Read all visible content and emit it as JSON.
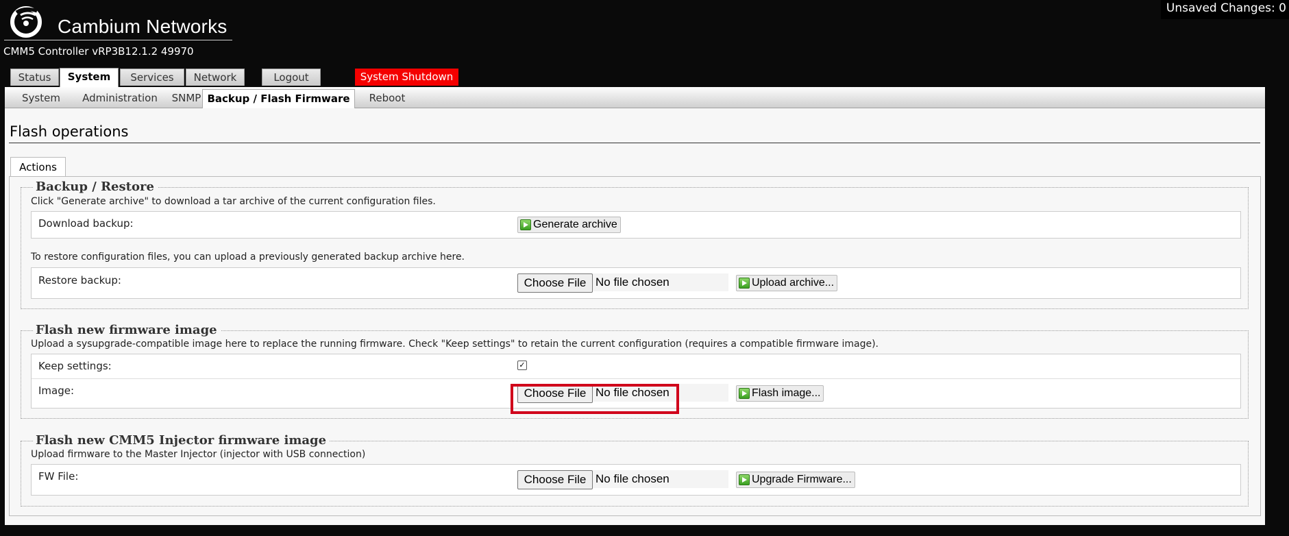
{
  "header": {
    "brand": "Cambium Networks",
    "version": "CMM5 Controller vRP3B12.1.2 49970",
    "unsaved_changes": "Unsaved Changes: 0"
  },
  "main_tabs": [
    {
      "label": "Status",
      "active": false
    },
    {
      "label": "System",
      "active": true
    },
    {
      "label": "Services",
      "active": false
    },
    {
      "label": "Network",
      "active": false
    },
    {
      "label": "Logout",
      "active": false
    }
  ],
  "shutdown_label": "System Shutdown",
  "sub_tabs": [
    {
      "label": "System",
      "active": false
    },
    {
      "label": "Administration",
      "active": false
    },
    {
      "label": "SNMP",
      "active": false
    },
    {
      "label": "Backup / Flash Firmware",
      "active": true
    },
    {
      "label": "Reboot",
      "active": false
    }
  ],
  "page": {
    "title": "Flash operations",
    "section_tab": "Actions"
  },
  "backup": {
    "legend": "Backup / Restore",
    "desc1": "Click \"Generate archive\" to download a tar archive of the current configuration files.",
    "download_label": "Download backup:",
    "generate_button": "Generate archive",
    "desc2": "To restore configuration files, you can upload a previously generated backup archive here.",
    "restore_label": "Restore backup:",
    "choose_file": "Choose File",
    "no_file": "No file chosen",
    "upload_button": "Upload archive..."
  },
  "firmware": {
    "legend": "Flash new firmware image",
    "desc": "Upload a sysupgrade-compatible image here to replace the running firmware. Check \"Keep settings\" to retain the current configuration (requires a compatible firmware image).",
    "keep_label": "Keep settings:",
    "keep_checked": true,
    "image_label": "Image:",
    "choose_file": "Choose File",
    "no_file": "No file chosen",
    "flash_button": "Flash image..."
  },
  "injector": {
    "legend": "Flash new CMM5 Injector firmware image",
    "desc": "Upload firmware to the Master Injector (injector with USB connection)",
    "fw_label": "FW File:",
    "choose_file": "Choose File",
    "no_file": "No file chosen",
    "upgrade_button": "Upgrade Firmware..."
  },
  "colors": {
    "shutdown_bg": "#f40000",
    "highlight": "#d0021b",
    "page_bg": "#0a0a0a"
  }
}
